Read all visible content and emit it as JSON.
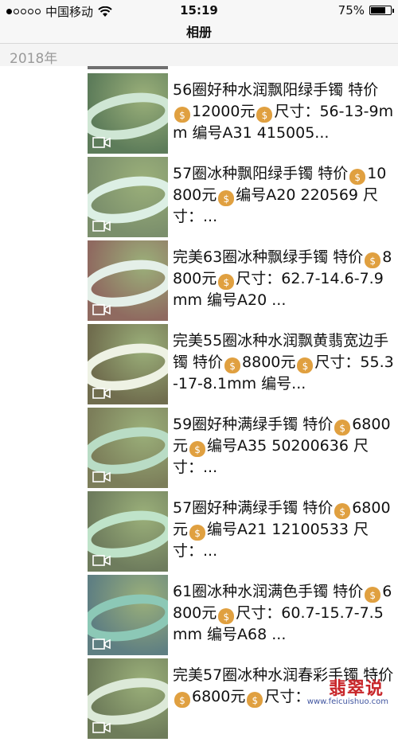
{
  "status_bar": {
    "carrier": "中国移动",
    "time": "15:19",
    "battery_pct": "75%",
    "battery_level": 0.75,
    "signal_bars": 1
  },
  "nav": {
    "title": "相册"
  },
  "section": {
    "year": "2018年"
  },
  "items": [
    {
      "before": "56圈好种水润飘阳绿手镯 特价",
      "mid": "12000元",
      "after": "尺寸：56-13-9mm 编号A31 415005..."
    },
    {
      "before": "57圈冰种飘阳绿手镯 特价",
      "mid": "10800元",
      "after": "编号A20 220569 尺寸：..."
    },
    {
      "before": "完美63圈冰种飘绿手镯 特价",
      "mid": "8800元",
      "after": "尺寸：62.7-14.6-7.9mm 编号A20 ..."
    },
    {
      "before": "完美55圈冰种水润飘黄翡宽边手镯 特价",
      "mid": "8800元",
      "after": "尺寸：55.3-17-8.1mm 编号..."
    },
    {
      "before": "59圈好种满绿手镯 特价",
      "mid": "6800元",
      "after": "编号A35 50200636 尺寸：..."
    },
    {
      "before": "57圈好种满绿手镯 特价",
      "mid": "6800元",
      "after": "编号A21 12100533 尺寸：..."
    },
    {
      "before": "61圈冰种水润满色手镯 特价",
      "mid": "6800元",
      "after": "尺寸：60.7-15.7-7.5mm 编号A68 ..."
    },
    {
      "before": "完美57圈冰种水润春彩手镯 特价",
      "mid": "6800元",
      "after": "尺寸："
    }
  ],
  "icons": {
    "money": "money-bag-icon",
    "video": "video-camera-icon"
  },
  "watermark": {
    "brand": "翡翠说",
    "url": "www.feicuishuo.com"
  }
}
